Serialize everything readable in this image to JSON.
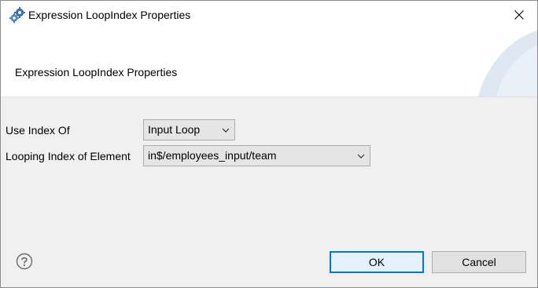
{
  "window": {
    "title": "Expression LoopIndex Properties",
    "icons": {
      "app": "gears-icon",
      "close": "close-icon"
    }
  },
  "banner": {
    "title": "Expression LoopIndex Properties"
  },
  "form": {
    "use_index_of": {
      "label": "Use Index Of",
      "value": "Input Loop"
    },
    "looping_index": {
      "label": "Looping Index of Element",
      "value": "in$/employees_input/team"
    }
  },
  "footer": {
    "help_icon": "help-icon",
    "ok_label": "OK",
    "cancel_label": "Cancel"
  },
  "colors": {
    "accent": "#0078d7",
    "banner_deco": "#dfe7f2",
    "dialog_bg": "#f0f0f0"
  }
}
